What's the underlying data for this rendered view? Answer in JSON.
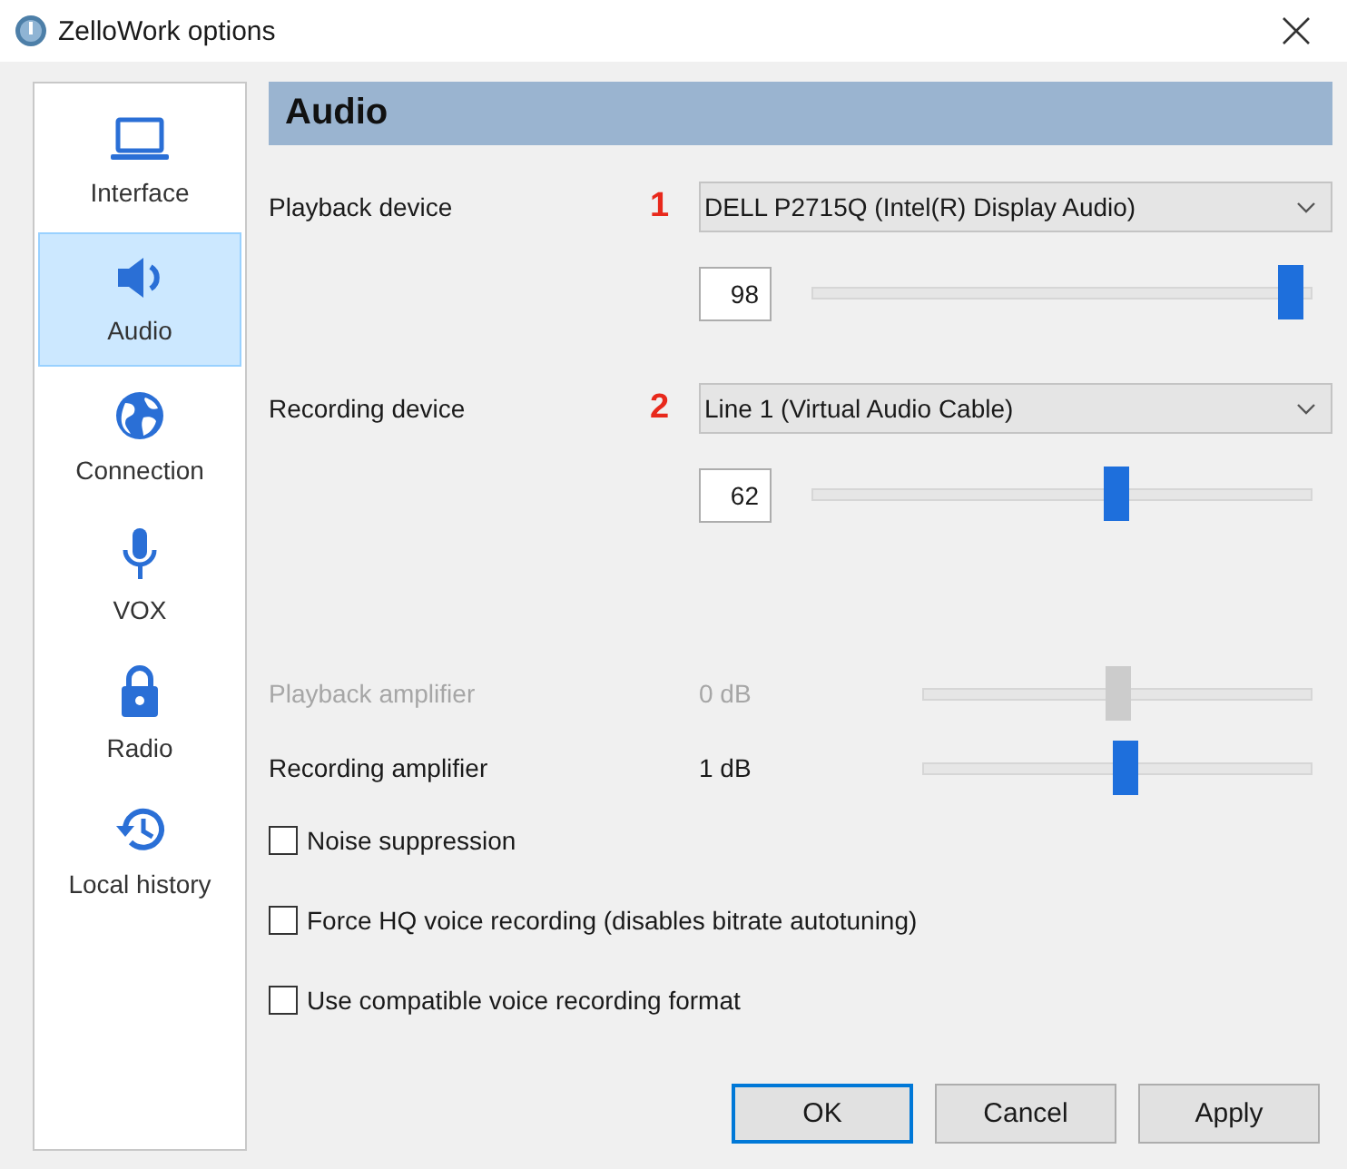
{
  "window": {
    "title": "ZelloWork options"
  },
  "sidebar": {
    "items": [
      {
        "label": "Interface",
        "selected": false
      },
      {
        "label": "Audio",
        "selected": true
      },
      {
        "label": "Connection",
        "selected": false
      },
      {
        "label": "VOX",
        "selected": false
      },
      {
        "label": "Radio",
        "selected": false
      },
      {
        "label": "Local history",
        "selected": false
      }
    ]
  },
  "section": {
    "title": "Audio"
  },
  "devices": [
    {
      "label": "Playback device",
      "annotation": "1",
      "device": "DELL P2715Q (Intel(R) Display Audio)",
      "volume": "98",
      "level": 0.96
    },
    {
      "label": "Recording device",
      "annotation": "2",
      "device": "Line 1 (Virtual Audio Cable)",
      "volume": "62",
      "level": 0.61
    }
  ],
  "amplifiers": [
    {
      "label": "Playback amplifier",
      "reading": "0 dB",
      "level": 0.5,
      "disabled": true
    },
    {
      "label": "Recording amplifier",
      "reading": "1 dB",
      "level": 0.52,
      "disabled": false
    }
  ],
  "options": [
    {
      "label": "Noise suppression",
      "checked": false
    },
    {
      "label": "Force HQ voice recording (disables bitrate autotuning)",
      "checked": false
    },
    {
      "label": "Use compatible voice recording format",
      "checked": false
    }
  ],
  "buttons": [
    {
      "label": "OK",
      "default": true
    },
    {
      "label": "Cancel",
      "default": false
    },
    {
      "label": "Apply",
      "default": false
    }
  ]
}
